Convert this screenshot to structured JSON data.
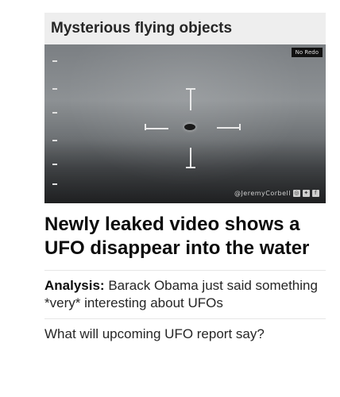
{
  "section": {
    "title": "Mysterious flying objects"
  },
  "media": {
    "badge": "No Redo",
    "watermark": "@JeremyCorbell",
    "watermark_icons": [
      "instagram-icon",
      "twitter-icon",
      "facebook-icon"
    ]
  },
  "headline": "Newly leaked video shows a UFO disappear into the water",
  "related": [
    {
      "prefix": "Analysis:",
      "text": "Barack Obama just said something *very* interesting about UFOs"
    },
    {
      "prefix": "",
      "text": "What will upcoming UFO report say?"
    }
  ]
}
